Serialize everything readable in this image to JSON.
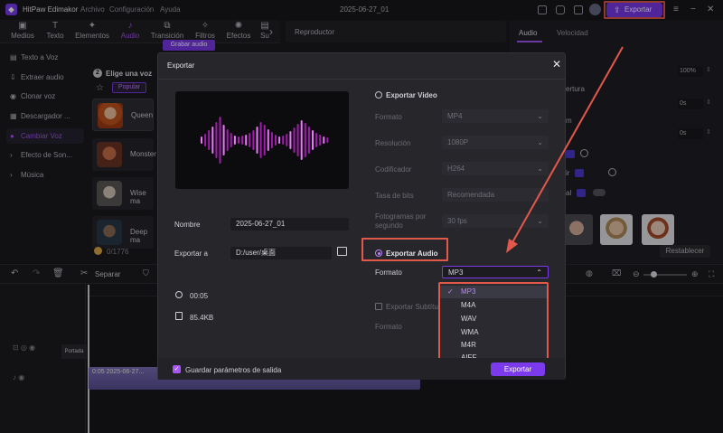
{
  "app": {
    "name": "HitPaw Edimakor",
    "project_title": "2025-06-27_01"
  },
  "menu": [
    "Archivo",
    "Configuración",
    "Ayuda"
  ],
  "title_actions": {
    "export_label": "Exportar"
  },
  "toolbar": [
    {
      "label": "Medios",
      "icon": "media-icon"
    },
    {
      "label": "Texto",
      "icon": "text-icon"
    },
    {
      "label": "Elementos",
      "icon": "elements-icon"
    },
    {
      "label": "Audio",
      "icon": "audio-icon"
    },
    {
      "label": "Transición",
      "icon": "transition-icon"
    },
    {
      "label": "Filtros",
      "icon": "filters-icon"
    },
    {
      "label": "Efectos",
      "icon": "effects-icon"
    },
    {
      "label": "Su",
      "icon": "subtitle-icon"
    }
  ],
  "sidebar": [
    {
      "label": "Texto a Voz"
    },
    {
      "label": "Extraer audio"
    },
    {
      "label": "Clonar voz"
    },
    {
      "label": "Descargador ..."
    },
    {
      "label": "Cambiar Voz"
    },
    {
      "label": "Efecto de Son..."
    },
    {
      "label": "Música"
    }
  ],
  "voice_panel": {
    "step_title": "Elige una voz",
    "step_number": "2",
    "filter": "Popular",
    "record_button": "Grabar audio",
    "voices": [
      {
        "name": "Queen"
      },
      {
        "name": "Monster"
      },
      {
        "name": "Wise ma"
      },
      {
        "name": "Deep ma"
      }
    ],
    "credits": "0/1776"
  },
  "preview": {
    "title": "Reproductor"
  },
  "right_panel": {
    "tabs": [
      "Audio",
      "Velocidad"
    ],
    "volume_value": "100%",
    "fields": [
      "ertura",
      "0s",
      "m",
      "0s"
    ],
    "ai_labels": [
      "ai",
      "ir",
      "al"
    ],
    "reset_label": "Restablecer"
  },
  "timeline": {
    "split_label": "Separar",
    "track_label": "Portada",
    "clip_label": "0:05 2025-06-27..."
  },
  "dialog": {
    "title": "Exportar",
    "name_label": "Nombre",
    "name_value": "2025-06-27_01",
    "export_to_label": "Exportar a",
    "export_to_value": "D:/user/桌面",
    "duration": "00:05",
    "size": "85.4KB",
    "video": {
      "label": "Exportar Video",
      "format_label": "Formato",
      "format_value": "MP4",
      "resolution_label": "Resolución",
      "resolution_value": "1080P",
      "codec_label": "Codificador",
      "codec_value": "H264",
      "bitrate_label": "Tasa de bits",
      "bitrate_value": "Recomendada",
      "fps_label_1": "Fotogramas por",
      "fps_label_2": "segundo",
      "fps_value": "30 fps"
    },
    "audio": {
      "label": "Exportar Audio",
      "format_label": "Formato",
      "format_value": "MP3",
      "options": [
        "MP3",
        "M4A",
        "WAV",
        "WMA",
        "M4R",
        "AIFF"
      ],
      "selected": "MP3"
    },
    "subtitle": {
      "label": "Exportar Subtítu",
      "format_label": "Formato"
    },
    "save_params_label": "Guardar parámetros de salida",
    "export_button": "Exportar"
  },
  "colors": {
    "accent": "#7c3aed",
    "highlight_box": "#e4584b",
    "wave": "#c026d3"
  }
}
